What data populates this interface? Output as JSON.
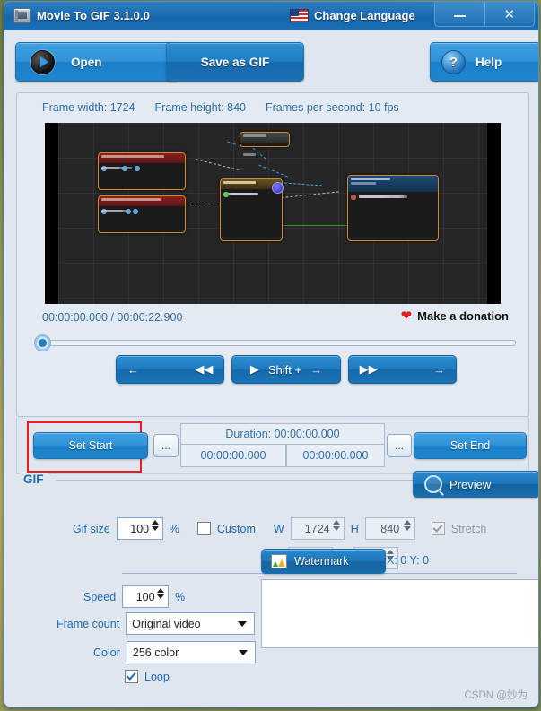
{
  "window": {
    "title": "Movie To GIF 3.1.0.0",
    "app_icon": "film-gif-icon",
    "language_button": "Change Language",
    "flag_icon": "us-flag-icon",
    "minimize": "–",
    "close": "✕"
  },
  "toolbar": {
    "open_label": "Open",
    "open_icon": "play-circle-icon",
    "save_label": "Save as GIF",
    "help_label": "Help",
    "help_icon": "question-circle-icon"
  },
  "video": {
    "frame_width_label": "Frame width: 1724",
    "frame_height_label": "Frame height: 840",
    "fps_label": "Frames per second: 10 fps",
    "timecode": "00:00:00.000 / 00:00:22.900",
    "donation_label": "Make a donation",
    "donation_icon": "heart-icon",
    "slider_position_percent": 0
  },
  "playback": {
    "prev_left_arrow": "←",
    "prev_rewind": "◀◀",
    "play_icon": "▶",
    "shift_label": "Shift +",
    "shift_arrow": "→",
    "next_forward": "▶▶",
    "next_right_arrow": "→"
  },
  "trim": {
    "set_start_label": "Set Start",
    "set_end_label": "Set End",
    "browse_left_label": "...",
    "browse_right_label": "...",
    "duration_label": "Duration: 00:00:00.000",
    "start_time": "00:00:00.000",
    "end_time": "00:00:00.000",
    "highlight_color": "#f01c1c"
  },
  "gif": {
    "group_label": "GIF",
    "preview_label": "Preview",
    "preview_icon": "magnifier-icon",
    "gif_size_label": "Gif size",
    "gif_size_value": "100",
    "percent_symbol": "%",
    "custom_label": "Custom",
    "custom_checked": false,
    "w_label": "W",
    "w_value": "1724",
    "h_label": "H",
    "h_value": "840",
    "stretch_label": "Stretch",
    "stretch_checked": true,
    "x_label": "X",
    "x_value": "0",
    "y_label": "Y",
    "y_value": "0",
    "speed_label": "Speed",
    "speed_value": "100",
    "speed_percent": "%",
    "frame_count_label": "Frame count",
    "frame_count_value": "Original video",
    "color_label": "Color",
    "color_value": "256 color",
    "loop_label": "Loop",
    "loop_checked": true,
    "watermark_label": "Watermark",
    "watermark_icon": "image-icon",
    "watermark_coords": "X: 0  Y: 0",
    "watermark_text": ""
  },
  "footer": {
    "credit": "CSDN @妙为"
  },
  "theme": {
    "accent": "#1e6bb0",
    "panel": "#dfe6f0",
    "titlebar": "#1d6cb0"
  }
}
